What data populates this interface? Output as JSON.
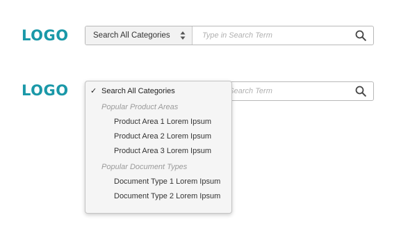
{
  "brand": {
    "logo_text": "LOGO",
    "logo_color": "#1a98a8"
  },
  "search": {
    "category_label": "Search All Categories",
    "placeholder": "Type in Search Term"
  },
  "dropdown": {
    "selected": "Search All Categories",
    "groups": [
      {
        "label": "Popular Product Areas",
        "items": [
          "Product Area 1 Lorem Ipsum",
          "Product Area 2 Lorem Ipsum",
          "Product Area 3 Lorem Ipsum"
        ]
      },
      {
        "label": "Popular Document Types",
        "items": [
          "Document Type 1 Lorem Ipsum",
          "Document Type 2 Lorem Ipsum"
        ]
      }
    ]
  },
  "icons": {
    "stepper": "select-stepper-icon",
    "search": "search-icon",
    "check": "checkmark-icon"
  }
}
